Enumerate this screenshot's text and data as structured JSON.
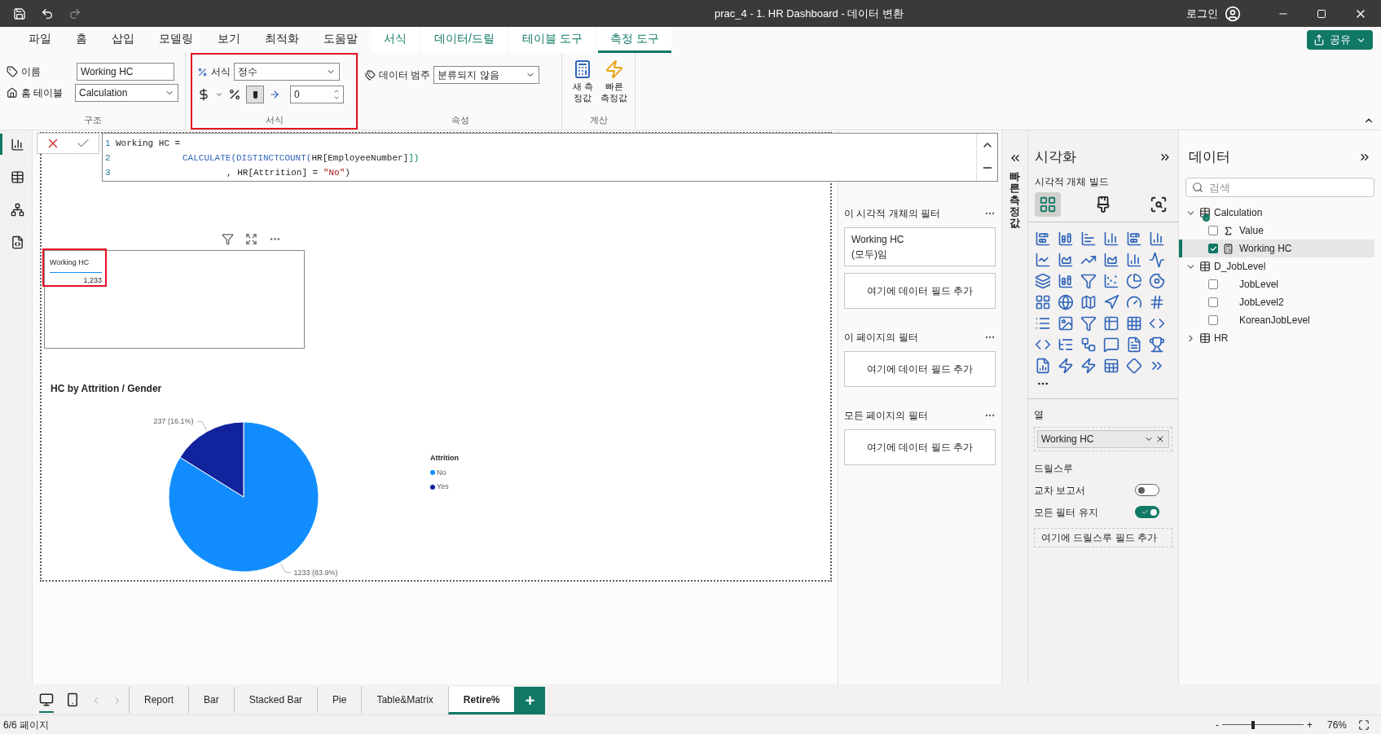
{
  "window": {
    "title": "prac_4 - 1. HR Dashboard - 데이터 변환",
    "user": "로그인"
  },
  "menu_tabs": [
    {
      "label": "파일",
      "kind": "standard",
      "selected": false
    },
    {
      "label": "홈",
      "kind": "standard",
      "selected": false
    },
    {
      "label": "삽입",
      "kind": "standard",
      "selected": false
    },
    {
      "label": "모델링",
      "kind": "standard",
      "selected": false
    },
    {
      "label": "보기",
      "kind": "standard",
      "selected": false
    },
    {
      "label": "최적화",
      "kind": "standard",
      "selected": false
    },
    {
      "label": "도움말",
      "kind": "standard",
      "selected": false
    },
    {
      "label": "서식",
      "kind": "contextual",
      "selected": false
    },
    {
      "label": "데이터/드릴",
      "kind": "contextual",
      "selected": false
    },
    {
      "label": "테이블 도구",
      "kind": "contextual",
      "selected": false
    },
    {
      "label": "측정 도구",
      "kind": "contextual",
      "selected": true
    }
  ],
  "share_button": "공유",
  "ribbon": {
    "structure": {
      "name_label": "이름",
      "name_value": "Working HC",
      "table_label": "홈 테이블",
      "table_value": "Calculation",
      "group_label": "구조"
    },
    "format": {
      "highlighted": true,
      "format_label": "서식",
      "format_value": "정수",
      "decimals": "0",
      "group_label": "서식"
    },
    "properties": {
      "category_label": "데이터 범주",
      "category_value": "분류되지 않음",
      "group_label": "속성"
    },
    "calculations": {
      "buttons": [
        {
          "label": "새 측정값",
          "kind": "new"
        },
        {
          "label": "빠른 측정값",
          "kind": "quick"
        }
      ],
      "group_label": "계산"
    }
  },
  "left_rail": [
    {
      "kind": "report",
      "selected": true
    },
    {
      "kind": "table",
      "selected": false
    },
    {
      "kind": "model",
      "selected": false
    },
    {
      "kind": "dax",
      "selected": false
    }
  ],
  "formula": {
    "lines": [
      {
        "number": "1",
        "tokens": [
          {
            "text": "Working HC =",
            "kind": "plain"
          }
        ]
      },
      {
        "number": "2",
        "tokens": [
          {
            "text": "CALCULATE(DISTINCTCOUNT(",
            "kind": "function"
          },
          {
            "text": "HR[EmployeeNumber]",
            "kind": "plain"
          },
          {
            "text": "])",
            "kind": "bracket"
          }
        ]
      },
      {
        "number": "3",
        "tokens": [
          {
            "text": ", HR[Attrition] = ",
            "kind": "plain"
          },
          {
            "text": "\"No\"",
            "kind": "string"
          },
          {
            "text": ")",
            "kind": "plain"
          }
        ]
      }
    ]
  },
  "card": {
    "highlighted": true,
    "title": "Working HC",
    "value": "1,233"
  },
  "pie": {
    "title": "HC by Attrition / Gender",
    "chart_data": {
      "type": "pie",
      "categories": [
        "No",
        "Yes"
      ],
      "values": [
        1233,
        237
      ],
      "colors": [
        "#118dff",
        "#12239e"
      ],
      "value_labels": [
        "1233 (83.9%)",
        "237 (16.1%)"
      ],
      "legend": {
        "title": "Attrition"
      }
    }
  },
  "filters": [
    {
      "title": "이 시각적 개체의 필터",
      "cards": [
        {
          "kind": "filter",
          "field": "Working HC",
          "condition": "(모두)임"
        },
        {
          "kind": "add",
          "label": "여기에 데이터 필드 추가"
        }
      ]
    },
    {
      "title": "이 페이지의 필터",
      "cards": [
        {
          "kind": "add",
          "label": "여기에 데이터 필드 추가"
        }
      ]
    },
    {
      "title": "모든 페이지의 필터",
      "cards": [
        {
          "kind": "add",
          "label": "여기에 데이터 필드 추가"
        }
      ]
    }
  ],
  "quick_measure_label": "빠른 측정값",
  "visualizations": {
    "title": "시각화",
    "subtitle": "시각적 개체 빌드",
    "build_tabs": [
      {
        "kind": "fields",
        "selected": true
      },
      {
        "kind": "format",
        "selected": false
      },
      {
        "kind": "analytics",
        "selected": false
      }
    ],
    "columns_label": "열",
    "column_field": "Working HC",
    "drillthrough_title": "드릴스루",
    "toggles": [
      {
        "label": "교차 보고서",
        "on": false
      },
      {
        "label": "모든 필터 유지",
        "on": true
      }
    ],
    "drillthrough_drop": "여기에 드릴스루 필드 추가"
  },
  "data": {
    "title": "데이터",
    "search": {
      "placeholder": "검색"
    },
    "tree": [
      {
        "label": "Calculation",
        "kind": "calc-table",
        "expanded": true,
        "selected": false,
        "children": [
          {
            "label": "Value",
            "kind": "sum",
            "checked": false,
            "selected": false
          },
          {
            "label": "Working HC",
            "kind": "measure",
            "checked": true,
            "selected": true
          }
        ]
      },
      {
        "label": "D_JobLevel",
        "kind": "table",
        "expanded": true,
        "selected": false,
        "children": [
          {
            "label": "JobLevel",
            "kind": "column",
            "checked": false,
            "selected": false
          },
          {
            "label": "JobLevel2",
            "kind": "column",
            "checked": false,
            "selected": false
          },
          {
            "label": "KoreanJobLevel",
            "kind": "column",
            "checked": false,
            "selected": false
          }
        ]
      },
      {
        "label": "HR",
        "kind": "table",
        "expanded": false,
        "selected": false
      }
    ]
  },
  "view_modes": [
    {
      "kind": "desktop",
      "selected": true
    },
    {
      "kind": "mobile",
      "selected": false
    }
  ],
  "page_tabs": [
    {
      "label": "Report",
      "selected": false
    },
    {
      "label": "Bar",
      "selected": false
    },
    {
      "label": "Stacked Bar",
      "selected": false
    },
    {
      "label": "Pie",
      "selected": false
    },
    {
      "label": "Table&Matrix",
      "selected": false
    },
    {
      "label": "Retire%",
      "selected": true
    }
  ],
  "add_page": "+",
  "status_bar": {
    "page": "6/6 페이지",
    "zoom_out": "-",
    "zoom_in": "+",
    "zoom": "76%",
    "level": 0.38
  }
}
